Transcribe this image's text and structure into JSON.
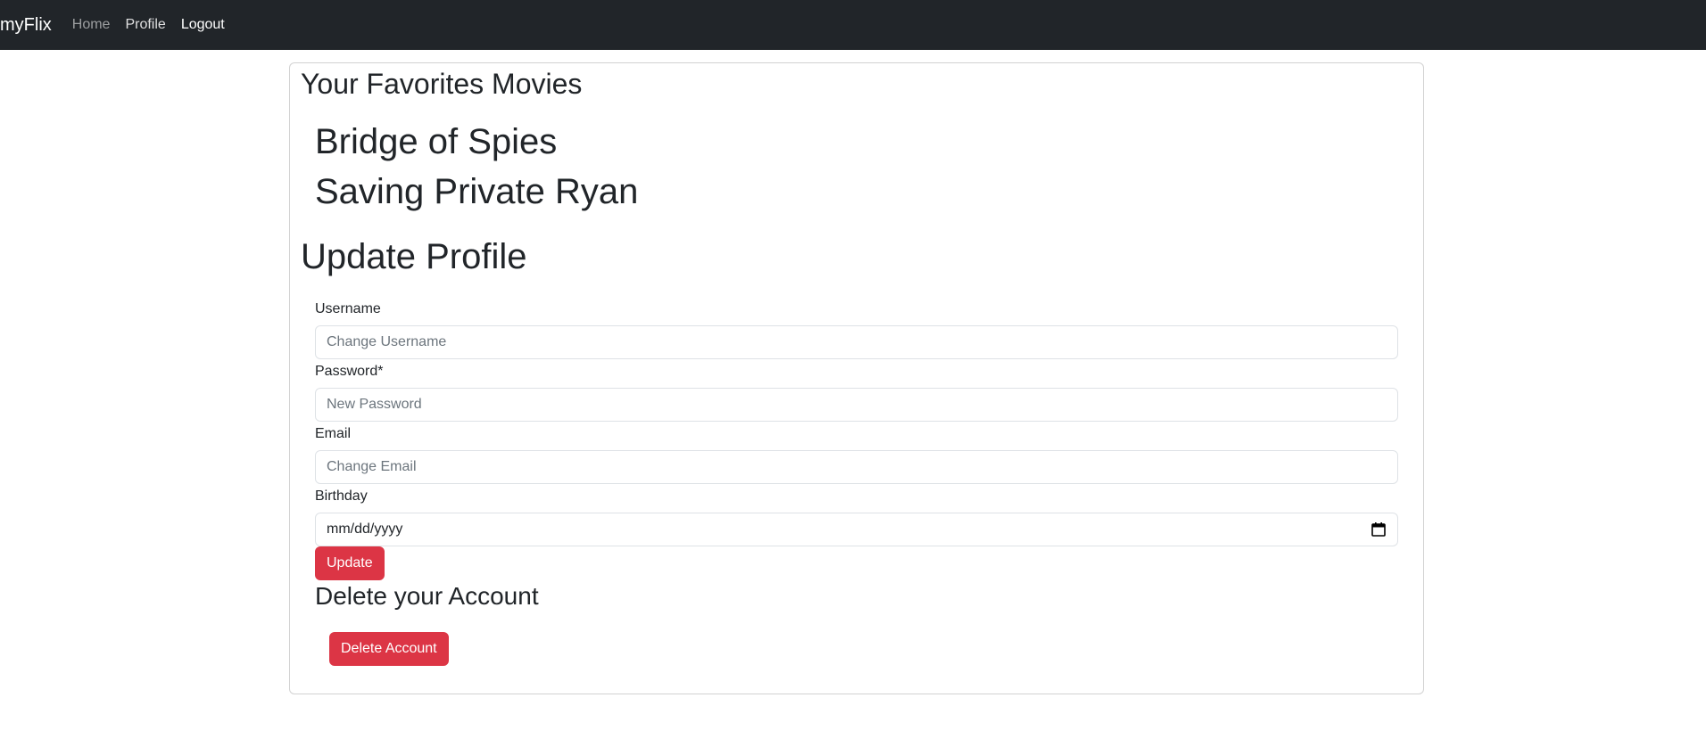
{
  "navbar": {
    "brand": "myFlix",
    "links": [
      {
        "label": "Home"
      },
      {
        "label": "Profile"
      },
      {
        "label": "Logout"
      }
    ]
  },
  "favorites": {
    "heading": "Your Favorites Movies",
    "movies": [
      "Bridge of Spies",
      "Saving Private Ryan"
    ]
  },
  "update_profile": {
    "heading": "Update Profile",
    "fields": {
      "username": {
        "label": "Username",
        "placeholder": "Change Username",
        "value": ""
      },
      "password": {
        "label": "Password*",
        "placeholder": "New Password",
        "value": ""
      },
      "email": {
        "label": "Email",
        "placeholder": "Change Email",
        "value": ""
      },
      "birthday": {
        "label": "Birthday",
        "placeholder": "mm/dd/yyyy",
        "value": ""
      }
    },
    "submit_label": "Update"
  },
  "delete_account": {
    "heading": "Delete your Account",
    "button_label": "Delete Account"
  },
  "colors": {
    "navbar_bg": "#212529",
    "danger": "#dc3545"
  },
  "icons": {
    "birthday_picker": "calendar-icon"
  }
}
